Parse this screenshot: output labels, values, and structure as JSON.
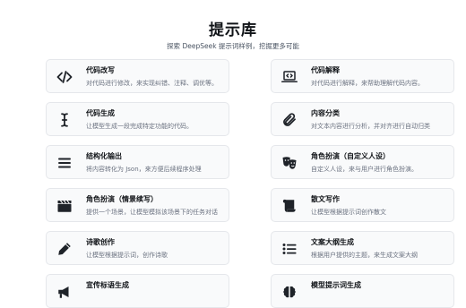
{
  "header": {
    "title": "提示库",
    "subtitle": "探索 DeepSeek 提示词样例，挖掘更多可能"
  },
  "cards": [
    {
      "title": "代码改写",
      "desc": "对代码进行修改，来实现纠错、注释、调优等。",
      "icon": "code-icon"
    },
    {
      "title": "代码解释",
      "desc": "对代码进行解释，来帮助理解代码内容。",
      "icon": "laptop-code-icon"
    },
    {
      "title": "代码生成",
      "desc": "让模型生成一段完成特定功能的代码。",
      "icon": "cursor-text-icon"
    },
    {
      "title": "内容分类",
      "desc": "对文本内容进行分析，并对齐进行自动归类",
      "icon": "paperclip-icon"
    },
    {
      "title": "结构化输出",
      "desc": "将内容转化为 Json，来方便后续程序处理",
      "icon": "list-bars-icon"
    },
    {
      "title": "角色扮演（自定义人设）",
      "desc": "自定义人设，来与用户进行角色扮演。",
      "icon": "theater-masks-icon"
    },
    {
      "title": "角色扮演（情景续写）",
      "desc": "提供一个场景，让模型模拟该场景下的任务对话",
      "icon": "clapperboard-icon"
    },
    {
      "title": "散文写作",
      "desc": "让模型根据提示词创作散文",
      "icon": "scroll-icon"
    },
    {
      "title": "诗歌创作",
      "desc": "让模型根据提示词，创作诗歌",
      "icon": "pen-icon"
    },
    {
      "title": "文案大纲生成",
      "desc": "根据用户提供的主题，来生成文案大纲",
      "icon": "list-icon"
    },
    {
      "title": "宣传标语生成",
      "desc": "",
      "icon": "megaphone-icon"
    },
    {
      "title": "模型提示词生成",
      "desc": "",
      "icon": "brain-icon"
    }
  ]
}
